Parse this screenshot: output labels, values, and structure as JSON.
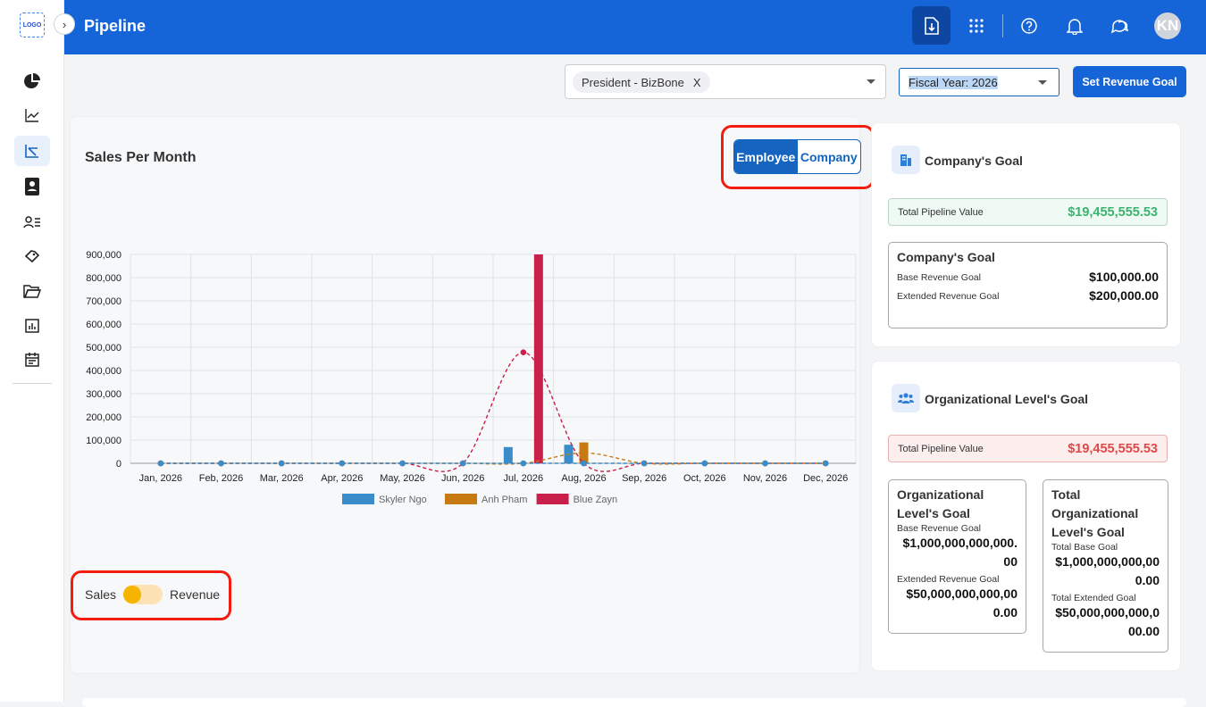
{
  "app": {
    "logo_text": "LOGO",
    "page_title": "Pipeline",
    "avatar_initials": "KN"
  },
  "filters": {
    "employee_chip": "President - BizBone",
    "chip_remove": "X",
    "fiscal_year": "Fiscal Year: 2026",
    "set_goal_button": "Set Revenue Goal"
  },
  "chart_card": {
    "title": "Sales Per Month",
    "toggle_employee": "Employee",
    "toggle_company": "Company",
    "switch_left": "Sales",
    "switch_right": "Revenue"
  },
  "chart_data": {
    "type": "bar",
    "categories": [
      "Jan, 2026",
      "Feb, 2026",
      "Mar, 2026",
      "Apr, 2026",
      "May, 2026",
      "Jun, 2026",
      "Jul, 2026",
      "Aug, 2026",
      "Sep, 2026",
      "Oct, 2026",
      "Nov, 2026",
      "Dec, 2026"
    ],
    "ylim": [
      0,
      900000
    ],
    "yticks": [
      0,
      100000,
      200000,
      300000,
      400000,
      500000,
      600000,
      700000,
      800000,
      900000
    ],
    "ytick_labels": [
      "0",
      "100,000",
      "200,000",
      "300,000",
      "400,000",
      "500,000",
      "600,000",
      "700,000",
      "800,000",
      "900,000"
    ],
    "series": [
      {
        "name": "Skyler Ngo",
        "color": "#3a8dc8",
        "values": [
          0,
          0,
          0,
          0,
          0,
          0,
          70000,
          80000,
          0,
          0,
          0,
          0
        ]
      },
      {
        "name": "Anh Pham",
        "color": "#c77a12",
        "values": [
          0,
          0,
          0,
          0,
          0,
          0,
          0,
          90000,
          0,
          0,
          0,
          0
        ]
      },
      {
        "name": "Blue Zayn",
        "color": "#c8204a",
        "values": [
          0,
          0,
          0,
          0,
          0,
          0,
          900000,
          0,
          0,
          0,
          0,
          0
        ]
      }
    ],
    "trend_lines": [
      {
        "color": "#c8204a",
        "values": [
          0,
          0,
          0,
          0,
          0,
          0,
          478000,
          0,
          0,
          0,
          0,
          0
        ]
      },
      {
        "color": "#c77a12",
        "values": [
          0,
          0,
          0,
          0,
          0,
          0,
          0,
          45000,
          0,
          0,
          0,
          0
        ]
      },
      {
        "color": "#3a8dc8",
        "values": [
          0,
          0,
          0,
          0,
          0,
          0,
          0,
          0,
          0,
          0,
          0,
          0
        ]
      }
    ],
    "grid": true,
    "legend": "bottom"
  },
  "company_goal": {
    "title": "Company's Goal",
    "pipeline_label": "Total Pipeline Value",
    "pipeline_value": "$19,455,555.53",
    "box_title": "Company's Goal",
    "base_label": "Base Revenue Goal",
    "base_value": "$100,000.00",
    "ext_label": "Extended Revenue Goal",
    "ext_value": "$200,000.00"
  },
  "org_goal": {
    "title": "Organizational Level's Goal",
    "pipeline_label": "Total Pipeline Value",
    "pipeline_value": "$19,455,555.53",
    "left_title": "Organizational Level's Goal",
    "left_base_label": "Base Revenue Goal",
    "left_base_value": "$1,000,000,000,000.00",
    "left_ext_label": "Extended Revenue Goal",
    "left_ext_value": "$50,000,000,000,000.00",
    "right_title": "Total Organizational Level's Goal",
    "right_base_label": "Total Base Goal",
    "right_base_value": "$1,000,000,000,000.00",
    "right_ext_label": "Total Extended Goal",
    "right_ext_value": "$50,000,000,000,000.00"
  },
  "colors": {
    "primary": "#1565d8",
    "highlight": "#f21d0e",
    "success": "#3cb371",
    "danger": "#e04848"
  }
}
